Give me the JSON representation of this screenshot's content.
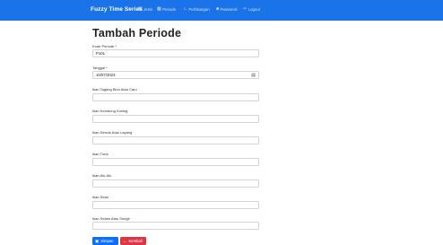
{
  "navbar": {
    "brand": "Fuzzy Time Series",
    "items": [
      {
        "label": "Jenis",
        "icon": "table-icon"
      },
      {
        "label": "Periode",
        "icon": "calendar-icon"
      },
      {
        "label": "Perhitungan",
        "icon": "chart-icon"
      },
      {
        "label": "Password",
        "icon": "lock-icon"
      },
      {
        "label": "Logout",
        "icon": "logout-icon"
      }
    ]
  },
  "page": {
    "title": "Tambah Periode"
  },
  "form": {
    "kode": {
      "label": "Kode Periode *",
      "value": "P101"
    },
    "tanggal": {
      "label": "Tanggal *",
      "value": "10/07/2023"
    },
    "fields": [
      {
        "label": "Ikan Tagang Bion Atau Caru",
        "value": ""
      },
      {
        "label": "Ikan Kembung Kuning",
        "value": ""
      },
      {
        "label": "Ikan Dencis Atau Layang",
        "value": ""
      },
      {
        "label": "Ikan Tuna",
        "value": ""
      },
      {
        "label": "Ikan Alu-Alu",
        "value": ""
      },
      {
        "label": "Ikan Selar",
        "value": ""
      },
      {
        "label": "Ikan Selam Atau Sungir",
        "value": ""
      }
    ]
  },
  "buttons": {
    "save": "Simpan",
    "back": "Kembali"
  },
  "colors": {
    "navbar": "#1a73e8",
    "save": "#0d6efd",
    "back": "#dc3545"
  }
}
